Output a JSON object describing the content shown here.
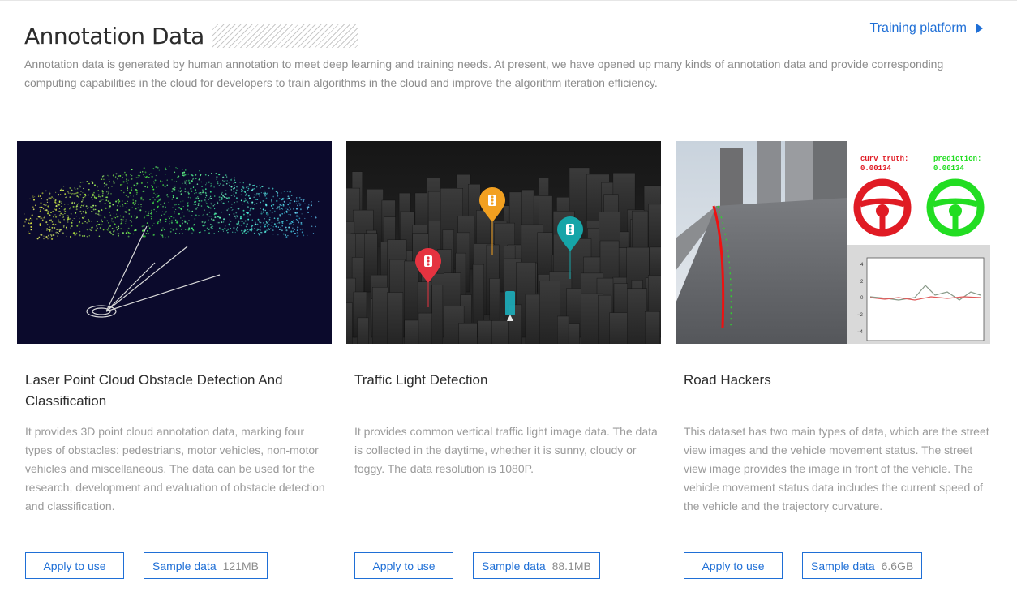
{
  "header": {
    "title": "Annotation Data",
    "training_link": "Training platform",
    "intro": "Annotation data is generated by human annotation to meet deep learning and training needs. At present, we have opened up many kinds of annotation data and provide corresponding computing capabilities in the cloud for developers to train algorithms in the cloud and improve the algorithm iteration efficiency."
  },
  "cards": [
    {
      "title": "Laser Point Cloud Obstacle Detection And Classification",
      "description": "It provides 3D point cloud annotation data, marking four types of obstacles: pedestrians, motor vehicles, non-motor vehicles and miscellaneous. The data can be used for the research, development and evaluation of obstacle detection and classification.",
      "apply_label": "Apply to use",
      "sample_label": "Sample data",
      "size": "121MB",
      "image_icon": "point-cloud-image"
    },
    {
      "title": "Traffic Light Detection",
      "description": "It provides common vertical traffic light image data. The data is collected in the daytime, whether it is sunny, cloudy or foggy. The data resolution is 1080P.",
      "apply_label": "Apply to use",
      "sample_label": "Sample data",
      "size": "88.1MB",
      "image_icon": "traffic-light-city-image"
    },
    {
      "title": "Road Hackers",
      "description": "This dataset has two main types of data, which are the street view images and the vehicle movement status. The street view image provides the image in front of the vehicle. The vehicle movement status data includes the current speed of the vehicle and the trajectory curvature.",
      "apply_label": "Apply to use",
      "sample_label": "Sample data",
      "size": "6.6GB",
      "image_icon": "road-view-image",
      "image_texts": {
        "truth_label": "curv truth:",
        "truth_value": "0.00134",
        "prediction_label": "prediction:",
        "prediction_value": "0.00134"
      }
    }
  ],
  "colors": {
    "accent": "#1f6fd6",
    "title": "#2c2c2c",
    "muted": "#9b9b9b",
    "pin_orange": "#f2a020",
    "pin_red": "#e53340",
    "pin_teal": "#16a5a8",
    "wheel_red": "#e01b24",
    "wheel_green": "#22dd22"
  }
}
